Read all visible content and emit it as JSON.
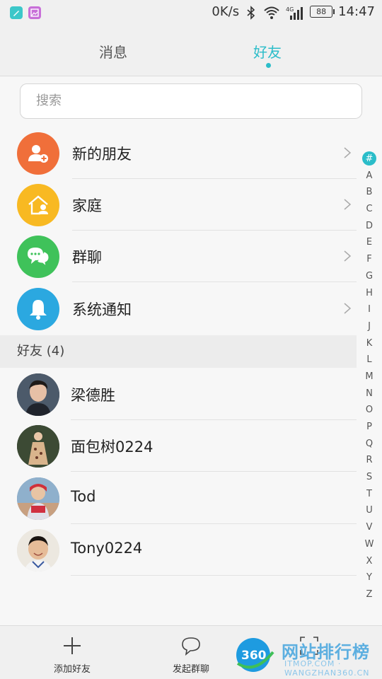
{
  "status_bar": {
    "speed": "0K/s",
    "network": "4G",
    "battery": "88",
    "time": "14:47",
    "icons": [
      "notes-app-icon",
      "gallery-app-icon",
      "bluetooth-icon",
      "wifi-icon",
      "signal-icon",
      "battery-icon"
    ]
  },
  "tabs": [
    {
      "label": "消息",
      "active": false
    },
    {
      "label": "好友",
      "active": true
    }
  ],
  "search": {
    "placeholder": "搜索"
  },
  "quick_items": [
    {
      "label": "新的朋友",
      "icon": "add-friend-icon",
      "color": "#f06f3a"
    },
    {
      "label": "家庭",
      "icon": "home-icon",
      "color": "#f8b922"
    },
    {
      "label": "群聊",
      "icon": "chat-bubbles-icon",
      "color": "#3fc25a"
    },
    {
      "label": "系统通知",
      "icon": "bell-icon",
      "color": "#2ba8e0"
    }
  ],
  "friends_header": "好友 (4)",
  "friends": [
    {
      "name": "梁德胜"
    },
    {
      "name": "面包树0224"
    },
    {
      "name": "Tod"
    },
    {
      "name": "Tony0224"
    }
  ],
  "index_letters": [
    "#",
    "A",
    "B",
    "C",
    "D",
    "E",
    "F",
    "G",
    "H",
    "I",
    "J",
    "K",
    "L",
    "M",
    "N",
    "O",
    "P",
    "Q",
    "R",
    "S",
    "T",
    "U",
    "V",
    "W",
    "X",
    "Y",
    "Z"
  ],
  "bottom_bar": [
    {
      "label": "添加好友",
      "icon": "plus-icon"
    },
    {
      "label": "发起群聊",
      "icon": "chat-bubble-icon"
    },
    {
      "label": "",
      "icon": "scan-icon"
    }
  ],
  "watermark": {
    "title": "网站排行榜",
    "subtitle": "ITMOP.COM",
    "sub2": "WANGZHAN360.CN",
    "badge": "360"
  },
  "colors": {
    "accent": "#2bbdc9"
  }
}
